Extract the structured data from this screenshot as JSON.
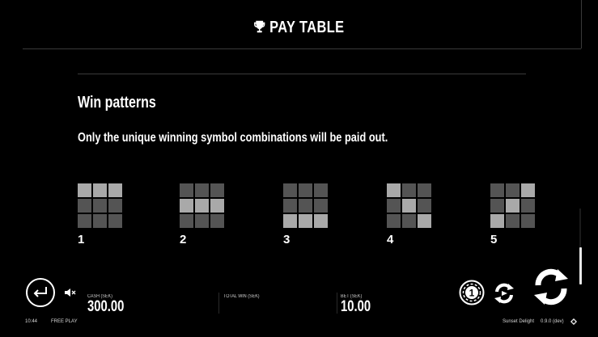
{
  "header": {
    "title": "PAY TABLE",
    "icon": "trophy-icon"
  },
  "content": {
    "heading": "Win patterns",
    "description": "Only the unique winning symbol combinations will be paid out.",
    "patterns": [
      {
        "label": "1",
        "cells": [
          1,
          1,
          1,
          0,
          0,
          0,
          0,
          0,
          0
        ]
      },
      {
        "label": "2",
        "cells": [
          0,
          0,
          0,
          1,
          1,
          1,
          0,
          0,
          0
        ]
      },
      {
        "label": "3",
        "cells": [
          0,
          0,
          0,
          0,
          0,
          0,
          1,
          1,
          1
        ]
      },
      {
        "label": "4",
        "cells": [
          1,
          0,
          0,
          0,
          1,
          0,
          0,
          0,
          1
        ]
      },
      {
        "label": "5",
        "cells": [
          0,
          0,
          1,
          0,
          1,
          0,
          1,
          0,
          0
        ]
      }
    ]
  },
  "footer": {
    "cash_label": "CASH (SEK)",
    "cash_value": "300.00",
    "total_win_label": "TOTAL WIN (SEK)",
    "total_win_value": "",
    "bet_label": "BET (SEK)",
    "bet_value": "10.00",
    "time": "10:44",
    "mode": "FREE PLAY",
    "game_name": "Sunset Delight",
    "version": "0.9.0 (dev)",
    "coin_value": "1"
  },
  "colors": {
    "background": "#000000",
    "cell_on": "#a9a9a9",
    "cell_off": "#545454",
    "text": "#ffffff"
  }
}
